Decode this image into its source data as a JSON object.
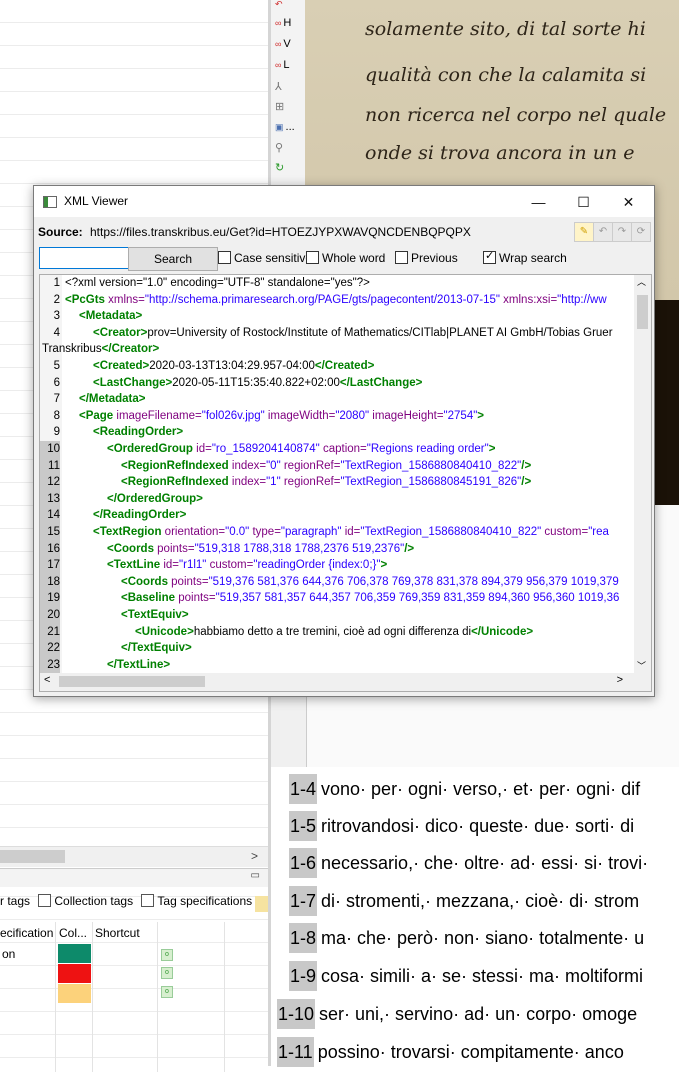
{
  "toolbar": {
    "items": [
      {
        "icon": "undo-icon",
        "label": ""
      },
      {
        "icon": "link-icon",
        "label": "H"
      },
      {
        "icon": "link-icon",
        "label": "V"
      },
      {
        "icon": "link-icon",
        "label": "L"
      },
      {
        "icon": "person-icon",
        "label": ""
      },
      {
        "icon": "table-icon",
        "label": ""
      },
      {
        "icon": "image-icon",
        "label": "..."
      },
      {
        "icon": "wrench-icon",
        "label": ""
      },
      {
        "icon": "redo-icon",
        "label": ""
      }
    ]
  },
  "manuscript": {
    "lines": [
      "solamente sito, di tal sorte hi",
      "qualità con che la calamita si",
      "non ricerca nel corpo nel quale",
      "onde si trova ancora in un e"
    ]
  },
  "dialog": {
    "title": "XML Viewer",
    "source_label": "Source:",
    "source_url": "https://files.transkribus.eu/Get?id=HTOEZJYPXWAVQNCDENBQPQPX",
    "search_value": "",
    "search_button": "Search",
    "options": {
      "case_sensitive": {
        "label": "Case sensitive",
        "checked": false
      },
      "whole_word": {
        "label": "Whole word",
        "checked": false
      },
      "previous": {
        "label": "Previous",
        "checked": false
      },
      "wrap_search": {
        "label": "Wrap search",
        "checked": true
      }
    },
    "line_numbers": [
      "1",
      "2",
      "3",
      "4",
      "",
      "5",
      "6",
      "7",
      "8",
      "9",
      "10",
      "11",
      "12",
      "13",
      "14",
      "15",
      "16",
      "17",
      "18",
      "19",
      "20",
      "21",
      "22",
      "23",
      "24"
    ]
  },
  "xml": {
    "l1": "<?xml version=\"1.0\" encoding=\"UTF-8\" standalone=\"yes\"?>",
    "l2_tag": "<PcGts",
    "l2_attr": " xmlns=",
    "l2_val": "\"http://schema.primaresearch.org/PAGE/gts/pagecontent/2013-07-15\"",
    "l2_attr2": " xmlns:xsi=",
    "l2_val2": "\"http://ww",
    "l3": "<Metadata>",
    "l4_tag": "<Creator>",
    "l4_text": "prov=University of Rostock/Institute of Mathematics/CITlab|PLANET AI GmbH/Tobias Gruer",
    "l4b_text": "Transkribus",
    "l4b_tag": "</Creator>",
    "l5_tag": "<Created>",
    "l5_text": "2020-03-13T13:04:29.957-04:00",
    "l5_end": "</Created>",
    "l6_tag": "<LastChange>",
    "l6_text": "2020-05-11T15:35:40.822+02:00",
    "l6_end": "</LastChange>",
    "l7": "</Metadata>",
    "l8_tag": "<Page",
    "l8_a1": " imageFilename=",
    "l8_v1": "\"fol026v.jpg\"",
    "l8_a2": " imageWidth=",
    "l8_v2": "\"2080\"",
    "l8_a3": " imageHeight=",
    "l8_v3": "\"2754\"",
    "l8_end": ">",
    "l9": "<ReadingOrder>",
    "l10_tag": "<OrderedGroup",
    "l10_a1": " id=",
    "l10_v1": "\"ro_1589204140874\"",
    "l10_a2": " caption=",
    "l10_v2": "\"Regions reading order\"",
    "l10_end": ">",
    "l11_tag": "<RegionRefIndexed",
    "l11_a1": " index=",
    "l11_v1": "\"0\"",
    "l11_a2": " regionRef=",
    "l11_v2": "\"TextRegion_1586880840410_822\"",
    "l11_end": "/>",
    "l12_tag": "<RegionRefIndexed",
    "l12_a1": " index=",
    "l12_v1": "\"1\"",
    "l12_a2": " regionRef=",
    "l12_v2": "\"TextRegion_1586880845191_826\"",
    "l12_end": "/>",
    "l13": "</OrderedGroup>",
    "l14": "</ReadingOrder>",
    "l15_tag": "<TextRegion",
    "l15_a1": " orientation=",
    "l15_v1": "\"0.0\"",
    "l15_a2": " type=",
    "l15_v2": "\"paragraph\"",
    "l15_a3": " id=",
    "l15_v3": "\"TextRegion_1586880840410_822\"",
    "l15_a4": " custom=",
    "l15_v4": "\"rea",
    "l16_tag": "<Coords",
    "l16_a1": " points=",
    "l16_v1": "\"519,318 1788,318 1788,2376 519,2376\"",
    "l16_end": "/>",
    "l17_tag": "<TextLine",
    "l17_a1": " id=",
    "l17_v1": "\"r1l1\"",
    "l17_a2": " custom=",
    "l17_v2": "\"readingOrder {index:0;}\"",
    "l17_end": ">",
    "l18_tag": "<Coords",
    "l18_a1": " points=",
    "l18_v1": "\"519,376 581,376 644,376 706,378 769,378 831,378 894,379 956,379 1019,379",
    "l19_tag": "<Baseline",
    "l19_a1": " points=",
    "l19_v1": "\"519,357 581,357 644,357 706,359 769,359 831,359 894,360 956,360 1019,36",
    "l20": "<TextEquiv>",
    "l21_tag": "<Unicode>",
    "l21_text": "habbiamo detto a tre tremini, cioè ad ogni differenza di",
    "l21_end": "</Unicode>",
    "l22": "</TextEquiv>",
    "l23": "</TextLine>"
  },
  "transcription": {
    "rows": [
      {
        "num": "1-4",
        "text": "vono· per· ogni· verso,· et· per· ogni· dif"
      },
      {
        "num": "1-5",
        "text": "ritrovandosi· dico· queste· due· sorti· di"
      },
      {
        "num": "1-6",
        "text": "necessario,· che· oltre· ad· essi· si· trovi·"
      },
      {
        "num": "1-7",
        "text": "di· stromenti,· mezzana,· cioè· di· strom"
      },
      {
        "num": "1-8",
        "text": "ma· che· però· non· siano· totalmente· u"
      },
      {
        "num": "1-9",
        "text": "cosa· simili· a· se· stessi· ma· moltiformi"
      },
      {
        "num": "1-10",
        "text": "ser· uni,· servino· ad· un· corpo· omoge"
      },
      {
        "num": "1-11",
        "text": "possino· trovarsi· compitamente· anco"
      }
    ]
  },
  "tags_panel": {
    "filters": {
      "partial": "r tags",
      "collection": "Collection tags",
      "specs": "Tag specifications"
    },
    "columns": {
      "spec": "ecification",
      "color": "Col...",
      "shortcut": "Shortcut"
    },
    "row_label": "on",
    "add_symbol": "o",
    "colors": [
      "#0d8a6a",
      "#ee1212",
      "#fcd27b"
    ]
  }
}
